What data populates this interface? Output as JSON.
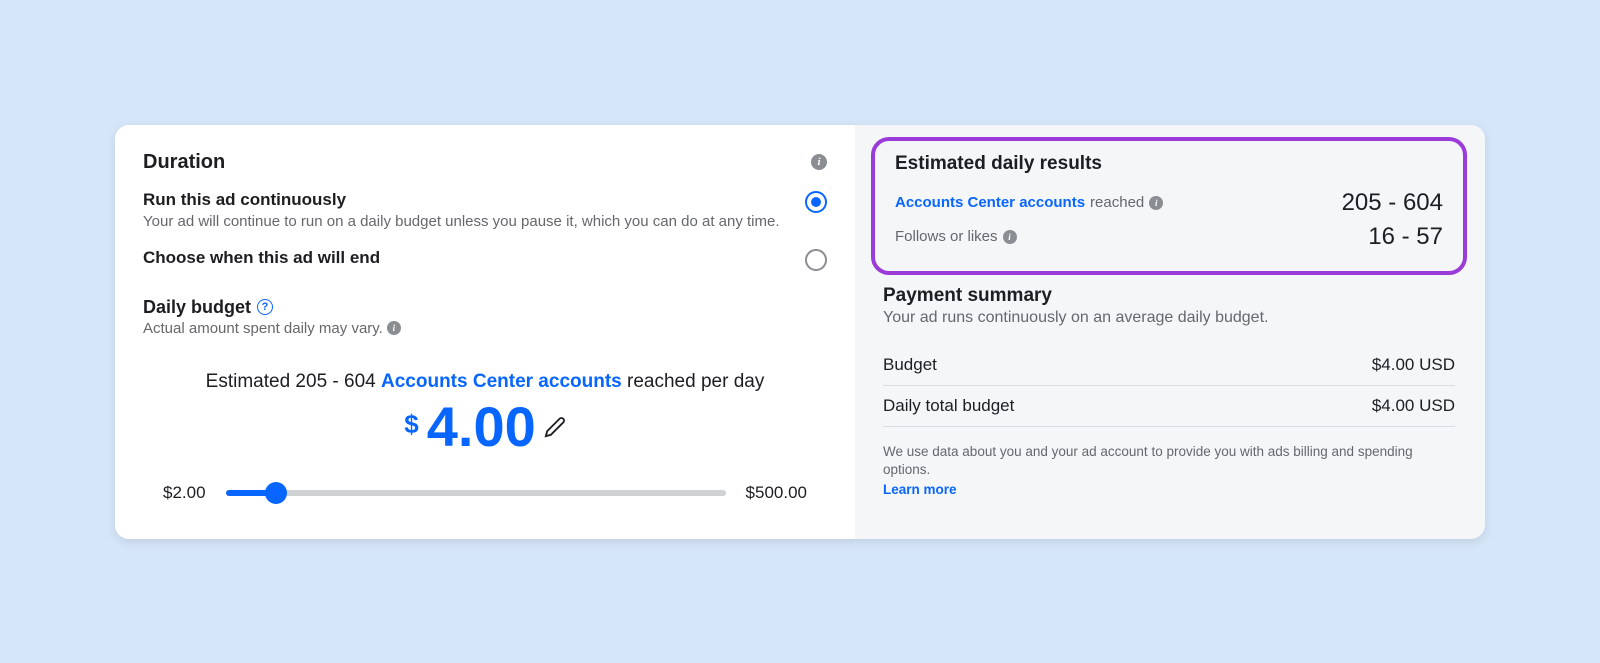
{
  "duration": {
    "title": "Duration",
    "opt1": {
      "label": "Run this ad continuously",
      "desc": "Your ad will continue to run on a daily budget unless you pause it, which you can do at any time."
    },
    "opt2": {
      "label": "Choose when this ad will end"
    }
  },
  "budget": {
    "title": "Daily budget",
    "sub": "Actual amount spent daily may vary.",
    "estimate_prefix": "Estimated 205 - 604 ",
    "estimate_link": "Accounts Center accounts",
    "estimate_suffix": " reached per day",
    "currency": "$",
    "amount": "4.00",
    "min": "$2.00",
    "max": "$500.00"
  },
  "results": {
    "title": "Estimated daily results",
    "row1_link": "Accounts Center accounts",
    "row1_suffix": " reached",
    "row1_val": "205 - 604",
    "row2_label": "Follows or likes",
    "row2_val": "16 - 57"
  },
  "payment": {
    "title": "Payment summary",
    "sub": "Your ad runs continuously on an average daily budget.",
    "row1_label": "Budget",
    "row1_val": "$4.00 USD",
    "row2_label": "Daily total budget",
    "row2_val": "$4.00 USD",
    "footnote": "We use data about you and your ad account to provide you with ads billing and spending options.",
    "learn": "Learn more"
  }
}
